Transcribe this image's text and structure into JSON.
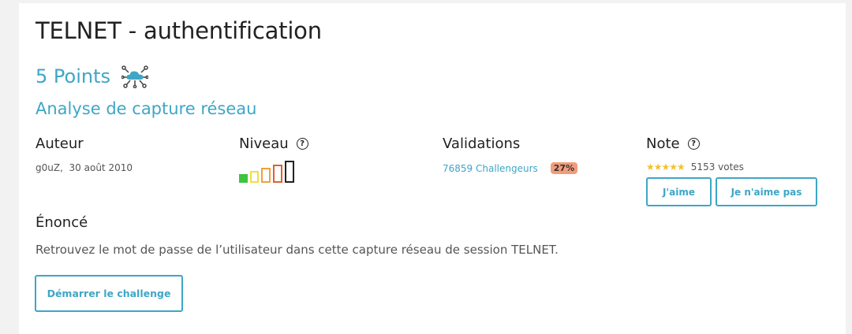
{
  "challenge": {
    "title": "TELNET - authentification",
    "points": "5 Points",
    "points_icon": "network-cloud-icon",
    "category": "Analyse de capture réseau"
  },
  "author": {
    "label": "Auteur",
    "name": "g0uZ,",
    "date": "30 août 2010"
  },
  "level": {
    "label": "Niveau",
    "current_level": 1,
    "total_levels": 5
  },
  "validations": {
    "label": "Validations",
    "challengers": "76859 Challengeurs",
    "percent": "27%"
  },
  "note": {
    "label": "Note",
    "stars": "★★★★★",
    "rating_out_of_5": 5,
    "votes": "5153 votes",
    "like": "J'aime",
    "dislike": "Je n'aime pas"
  },
  "statement": {
    "heading": "Énoncé",
    "text": "Retrouvez le mot de passe de l’utilisateur dans cette capture réseau de session TELNET."
  },
  "actions": {
    "start": "Démarrer le challenge"
  },
  "colors": {
    "accent": "#3ea6c6",
    "level_1": "#3ec43e",
    "level_2": "#f0e040",
    "level_3": "#f0a040",
    "level_4": "#e06030",
    "level_5": "#222222",
    "percent_badge": "#f39c7a",
    "star": "#f2c12e"
  }
}
